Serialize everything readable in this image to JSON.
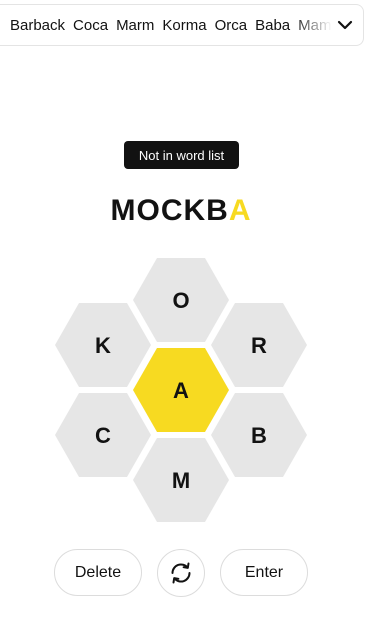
{
  "found_words": [
    "Barback",
    "Coca",
    "Marm",
    "Korma",
    "Orca",
    "Baba",
    "Mamba"
  ],
  "toast": {
    "message": "Not in word list"
  },
  "input": {
    "prefix": "MOCKB",
    "center": "A"
  },
  "hive": {
    "center": "A",
    "outer": [
      "O",
      "R",
      "B",
      "M",
      "C",
      "K"
    ]
  },
  "controls": {
    "delete_label": "Delete",
    "enter_label": "Enter",
    "shuffle_icon": "shuffle-icon",
    "expand_icon": "chevron-down-icon"
  },
  "colors": {
    "center_cell": "#f7da21",
    "outer_cell": "#e6e6e6",
    "text": "#121212"
  }
}
